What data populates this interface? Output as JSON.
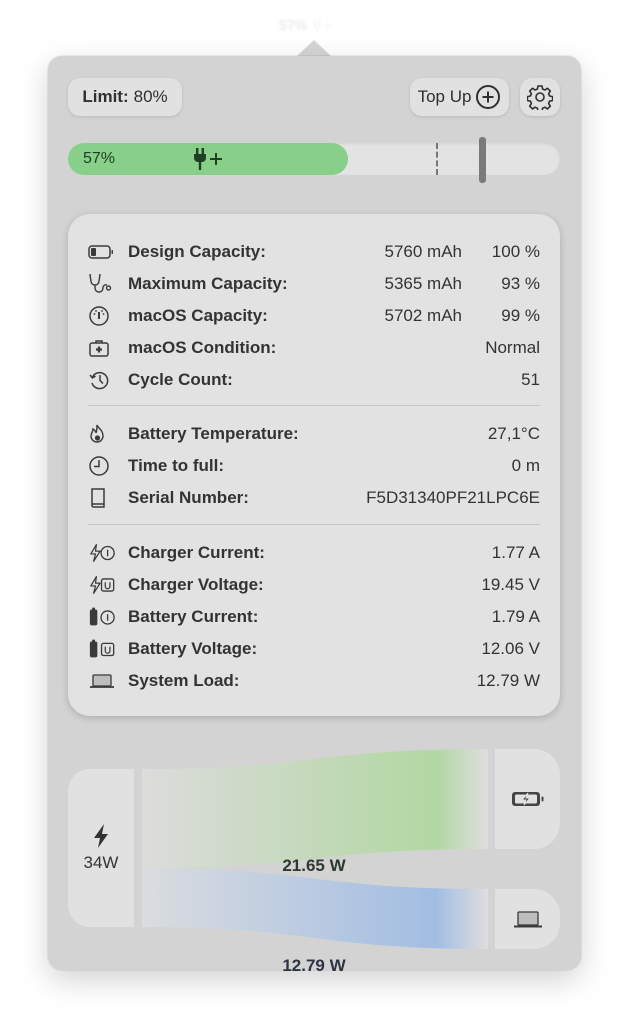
{
  "menubar": {
    "battery_percent": "57%",
    "status_icon": "plug-plus-icon"
  },
  "header": {
    "limit_label": "Limit:",
    "limit_value": "80%",
    "top_up_label": "Top Up",
    "top_up_icon": "plus-circle-icon",
    "settings_icon": "gear-icon"
  },
  "battery_bar": {
    "percent_label": "57%",
    "charge_fraction": 0.57,
    "limit_fraction": 0.8,
    "status_icon": "plug-plus-icon",
    "colors": {
      "fill": "#88cf8a",
      "track": "#e3e3e3"
    }
  },
  "info": {
    "capacity_rows": [
      {
        "icon": "battery-icon",
        "label": "Design Capacity:",
        "value": "5760 mAh",
        "percent": "100 %"
      },
      {
        "icon": "stethoscope-icon",
        "label": "Maximum Capacity:",
        "value": "5365 mAh",
        "percent": "93 %"
      },
      {
        "icon": "gauge-icon",
        "label": "macOS Capacity:",
        "value": "5702 mAh",
        "percent": "99 %"
      },
      {
        "icon": "medical-kit-icon",
        "label": "macOS Condition:",
        "value": "Normal"
      },
      {
        "icon": "history-icon",
        "label": "Cycle Count:",
        "value": "51"
      }
    ],
    "status_rows": [
      {
        "icon": "flame-icon",
        "label": "Battery Temperature:",
        "value": "27,1°C"
      },
      {
        "icon": "clock-icon",
        "label": "Time to full:",
        "value": "0 m"
      },
      {
        "icon": "book-icon",
        "label": "Serial Number:",
        "value": "F5D31340PF21LPC6E"
      }
    ],
    "power_rows": [
      {
        "icon": "charger-current-icon",
        "label": "Charger Current:",
        "value": "1.77 A"
      },
      {
        "icon": "charger-voltage-icon",
        "label": "Charger Voltage:",
        "value": "19.45 V"
      },
      {
        "icon": "battery-current-icon",
        "label": "Battery Current:",
        "value": "1.79 A"
      },
      {
        "icon": "battery-voltage-icon",
        "label": "Battery Voltage:",
        "value": "12.06 V"
      },
      {
        "icon": "laptop-icon",
        "label": "System Load:",
        "value": "12.79 W"
      }
    ]
  },
  "power_flow": {
    "source": {
      "icon": "bolt-icon",
      "label": "34W"
    },
    "battery_flow": {
      "label": "21.65 W",
      "icon": "battery-charging-icon",
      "color": "#b2d7a2"
    },
    "system_flow": {
      "label": "12.79 W",
      "icon": "laptop-icon",
      "color": "#a2bde3"
    }
  }
}
